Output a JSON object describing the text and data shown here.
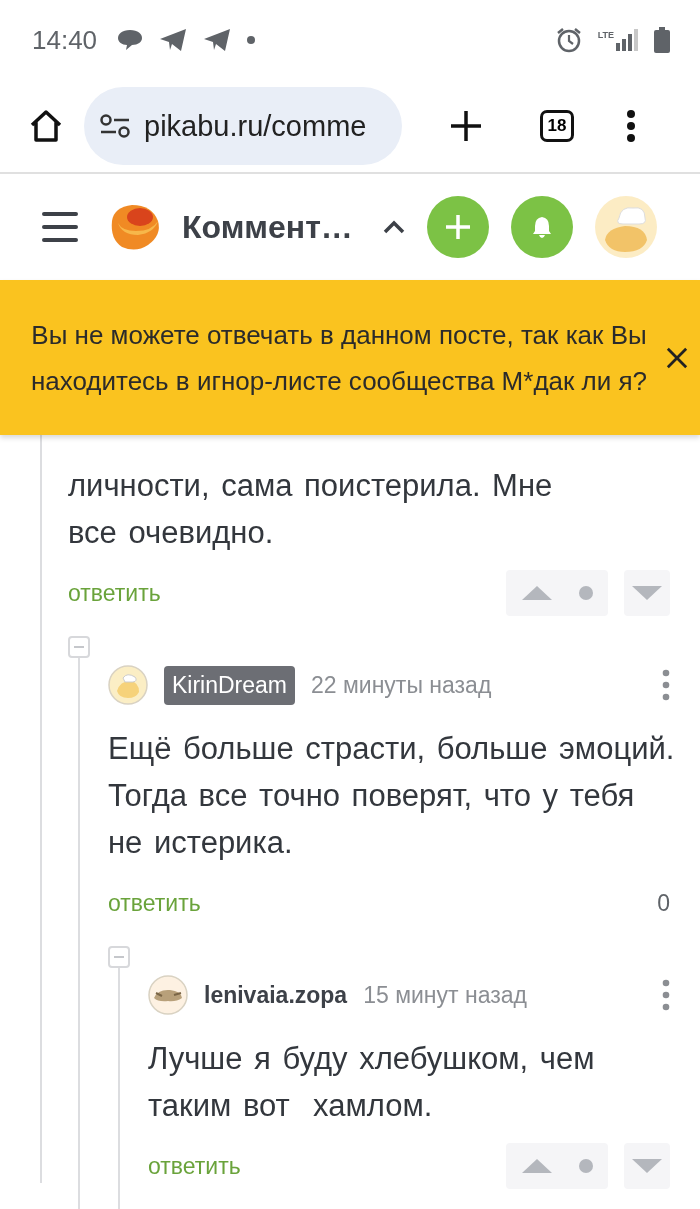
{
  "status_bar": {
    "time": "14:40",
    "network": "LTE"
  },
  "browser": {
    "url": "pikabu.ru/comme",
    "tab_count": "18"
  },
  "header": {
    "title": "Коммент…"
  },
  "banner": {
    "text": "Вы не можете отвечать в данном посте, так как Вы находитесь в игнор-листе сообщества М*дак ли я?"
  },
  "comments": [
    {
      "text": "личности, сама поистерила. Мне все очевидно.",
      "reply": "ответить",
      "footer": {
        "kind": "votes"
      },
      "children": [
        {
          "author": {
            "name": "KirinDream",
            "kind": "badge"
          },
          "time": "22 минуты назад",
          "text": "Ещё больше страсти, больше эмоций. Тогда все точно поверят, что у тебя не истерика.",
          "reply": "ответить",
          "footer": {
            "kind": "score",
            "score": "0"
          },
          "children": [
            {
              "author": {
                "name": "lenivaia.zopa",
                "kind": "plain"
              },
              "time": "15 минут назад",
              "text": "Лучше я буду хлебушком, чем таким вот  хамлом.",
              "reply": "ответить",
              "footer": {
                "kind": "votes"
              }
            }
          ]
        }
      ]
    }
  ]
}
